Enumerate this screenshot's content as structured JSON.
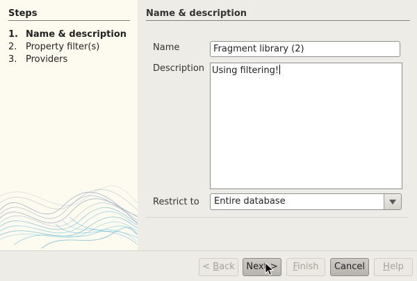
{
  "steps": {
    "title": "Steps",
    "items": [
      {
        "num": "1.",
        "label": "Name & description",
        "active": true
      },
      {
        "num": "2.",
        "label": "Property filter(s)",
        "active": false
      },
      {
        "num": "3.",
        "label": "Providers",
        "active": false
      }
    ]
  },
  "section": {
    "title": "Name & description"
  },
  "form": {
    "name_label": "Name",
    "name_value": "Fragment library (2)",
    "description_label": "Description",
    "description_value": "Using filtering!",
    "restrict_label": "Restrict to",
    "restrict_value": "Entire database"
  },
  "buttons": {
    "back": {
      "prefix": "< ",
      "mnemonic": "B",
      "rest": "ack"
    },
    "next": "Next >",
    "finish": {
      "mnemonic": "F",
      "rest": "inish"
    },
    "cancel": "Cancel",
    "help": {
      "mnemonic": "H",
      "rest": "elp"
    }
  },
  "icons": {
    "dropdown": "chevron-down-icon",
    "cursor": "mouse-pointer-icon"
  }
}
